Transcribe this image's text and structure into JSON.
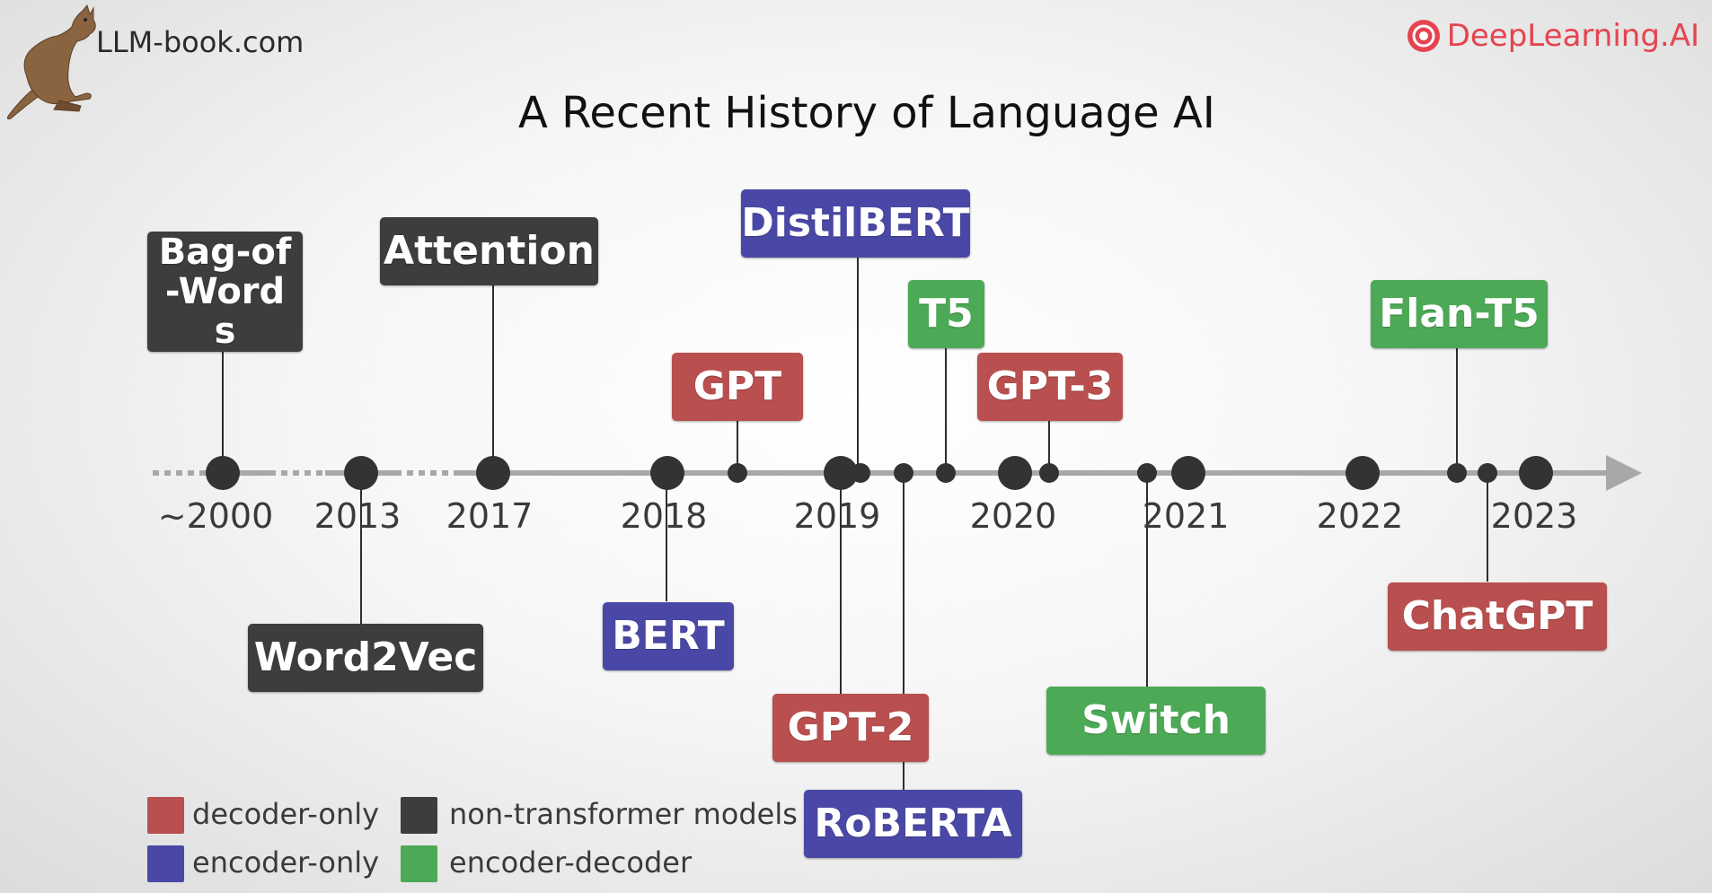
{
  "header": {
    "site_name": "LLM-book.com",
    "brand_name": "DeepLearning.AI",
    "title": "A Recent History of Language AI"
  },
  "colors": {
    "decoder_only": "#b94f4f",
    "encoder_only": "#4a48a6",
    "non_transformer": "#3d3d3d",
    "encoder_decoder": "#4caa56",
    "brand": "#e5444f"
  },
  "timeline": {
    "years": [
      "~2000",
      "2013",
      "2017",
      "2018",
      "2019",
      "2020",
      "2021",
      "2022",
      "2023"
    ],
    "models": [
      {
        "id": "bag-of-words",
        "label": "Bag-of-Words",
        "year_label": "~2000",
        "type": "non-transformer"
      },
      {
        "id": "word2vec",
        "label": "Word2Vec",
        "year_label": "2013",
        "type": "non-transformer"
      },
      {
        "id": "attention",
        "label": "Attention",
        "year_label": "2017",
        "type": "non-transformer"
      },
      {
        "id": "bert",
        "label": "BERT",
        "year_label": "2018",
        "type": "encoder-only"
      },
      {
        "id": "gpt",
        "label": "GPT",
        "year_label": "2018",
        "type": "decoder-only"
      },
      {
        "id": "gpt-2",
        "label": "GPT-2",
        "year_label": "2019",
        "type": "decoder-only"
      },
      {
        "id": "distilbert",
        "label": "DistilBERT",
        "year_label": "2019",
        "type": "encoder-only"
      },
      {
        "id": "roberta",
        "label": "RoBERTA",
        "year_label": "2019",
        "type": "encoder-only"
      },
      {
        "id": "t5",
        "label": "T5",
        "year_label": "2019",
        "type": "encoder-decoder"
      },
      {
        "id": "gpt-3",
        "label": "GPT-3",
        "year_label": "2020",
        "type": "decoder-only"
      },
      {
        "id": "switch",
        "label": "Switch",
        "year_label": "2020",
        "type": "encoder-decoder"
      },
      {
        "id": "flan-t5",
        "label": "Flan-T5",
        "year_label": "2022",
        "type": "encoder-decoder"
      },
      {
        "id": "chatgpt",
        "label": "ChatGPT",
        "year_label": "2022",
        "type": "decoder-only"
      }
    ]
  },
  "legend": [
    {
      "label": "decoder-only",
      "type": "decoder-only"
    },
    {
      "label": "non-transformer models",
      "type": "non-transformer"
    },
    {
      "label": "encoder-only",
      "type": "encoder-only"
    },
    {
      "label": "encoder-decoder",
      "type": "encoder-decoder"
    }
  ]
}
